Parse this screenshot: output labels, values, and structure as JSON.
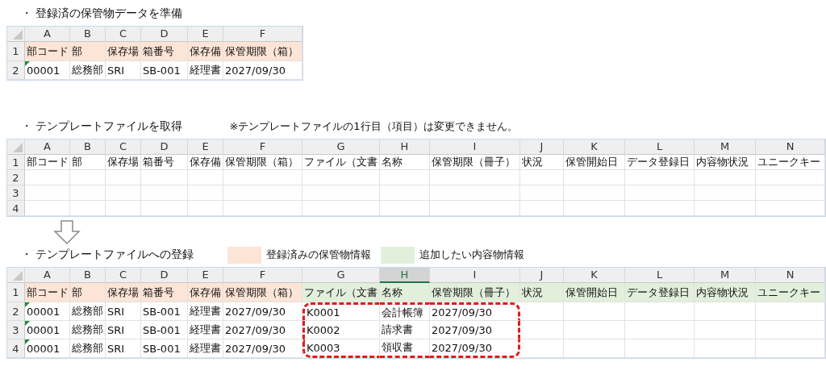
{
  "sections": [
    {
      "title": "・ 登録済の保管物データを準備",
      "sheet": {
        "columns": [
          {
            "label": "A",
            "selected": false
          },
          {
            "label": "B",
            "selected": false
          },
          {
            "label": "C",
            "selected": false
          },
          {
            "label": "D",
            "selected": false
          },
          {
            "label": "E",
            "selected": false
          },
          {
            "label": "F",
            "selected": false
          }
        ],
        "rows": [
          {
            "number": "1",
            "cells": [
              {
                "text": "部コード",
                "color": "#fce4d6"
              },
              {
                "text": "部",
                "color": "#fce4d6"
              },
              {
                "text": "保存場",
                "color": "#fce4d6"
              },
              {
                "text": "箱番号",
                "color": "#fce4d6"
              },
              {
                "text": "保存備",
                "color": "#fce4d6"
              },
              {
                "text": "保管期限（箱）",
                "color": "#fce4d6"
              }
            ]
          },
          {
            "number": "2",
            "cells": [
              {
                "text": "00001",
                "flag": true
              },
              {
                "text": "総務部"
              },
              {
                "text": "SRI"
              },
              {
                "text": "SB-001"
              },
              {
                "text": "経理書"
              },
              {
                "text": "2027/09/30"
              }
            ]
          }
        ]
      }
    },
    {
      "title": "・ テンプレートファイルを取得",
      "note": "※テンプレートファイルの1行目（項目）は変更できません。",
      "sheet": {
        "columns": [
          {
            "label": "A",
            "selected": false
          },
          {
            "label": "B",
            "selected": false
          },
          {
            "label": "C",
            "selected": false
          },
          {
            "label": "D",
            "selected": false
          },
          {
            "label": "E",
            "selected": false
          },
          {
            "label": "F",
            "selected": false
          },
          {
            "label": "G",
            "selected": false
          },
          {
            "label": "H",
            "selected": false
          },
          {
            "label": "I",
            "selected": false
          },
          {
            "label": "J",
            "selected": false
          },
          {
            "label": "K",
            "selected": false
          },
          {
            "label": "L",
            "selected": false
          },
          {
            "label": "M",
            "selected": false
          },
          {
            "label": "N",
            "selected": false
          }
        ],
        "rows": [
          {
            "number": "1",
            "cells": [
              {
                "text": "部コード"
              },
              {
                "text": "部"
              },
              {
                "text": "保存場"
              },
              {
                "text": "箱番号"
              },
              {
                "text": "保存備"
              },
              {
                "text": "保管期限（箱）"
              },
              {
                "text": "ファイル（文書"
              },
              {
                "text": "名称"
              },
              {
                "text": "保管期限（冊子）"
              },
              {
                "text": "状況"
              },
              {
                "text": "保管開始日"
              },
              {
                "text": "データ登録日"
              },
              {
                "text": "内容物状況"
              },
              {
                "text": "ユニークキー"
              }
            ]
          },
          {
            "number": "2"
          },
          {
            "number": "3"
          },
          {
            "number": "4"
          }
        ]
      }
    },
    {
      "title": "・ テンプレートファイルへの登録",
      "legend": [
        {
          "label": "登録済みの保管物情報",
          "color": "#fce4d6"
        },
        {
          "label": "追加したい内容物情報",
          "color": "#e2efda"
        }
      ],
      "sheet": {
        "columns": [
          {
            "label": "A",
            "selected": false
          },
          {
            "label": "B",
            "selected": false
          },
          {
            "label": "C",
            "selected": false
          },
          {
            "label": "D",
            "selected": false
          },
          {
            "label": "E",
            "selected": false
          },
          {
            "label": "F",
            "selected": false
          },
          {
            "label": "G",
            "selected": false
          },
          {
            "label": "H",
            "selected": true
          },
          {
            "label": "I",
            "selected": false
          },
          {
            "label": "J",
            "selected": false
          },
          {
            "label": "K",
            "selected": false
          },
          {
            "label": "L",
            "selected": false
          },
          {
            "label": "M",
            "selected": false
          },
          {
            "label": "N",
            "selected": false
          }
        ],
        "rows": [
          {
            "number": "1",
            "cells": [
              {
                "text": "部コード",
                "color": "#fce4d6"
              },
              {
                "text": "部",
                "color": "#fce4d6"
              },
              {
                "text": "保存場",
                "color": "#fce4d6"
              },
              {
                "text": "箱番号",
                "color": "#fce4d6"
              },
              {
                "text": "保存備",
                "color": "#fce4d6"
              },
              {
                "text": "保管期限（箱）",
                "color": "#fce4d6"
              },
              {
                "text": "ファイル（文書",
                "color": "#e2efda"
              },
              {
                "text": "名称",
                "color": "#e2efda"
              },
              {
                "text": "保管期限（冊子）",
                "color": "#e2efda"
              },
              {
                "text": "状況",
                "color": "#e2efda"
              },
              {
                "text": "保管開始日",
                "color": "#e2efda"
              },
              {
                "text": "データ登録日",
                "color": "#e2efda"
              },
              {
                "text": "内容物状況",
                "color": "#e2efda"
              },
              {
                "text": "ユニークキー",
                "color": "#e2efda"
              }
            ]
          },
          {
            "number": "2",
            "cells": [
              {
                "text": "00001",
                "flag": true
              },
              {
                "text": "総務部"
              },
              {
                "text": "SRI"
              },
              {
                "text": "SB-001"
              },
              {
                "text": "経理書"
              },
              {
                "text": "2027/09/30"
              },
              {
                "text": "K0001",
                "outlined": true
              },
              {
                "text": "会計帳簿",
                "outlined": true
              },
              {
                "text": "2027/09/30",
                "outlined": true
              }
            ]
          },
          {
            "number": "3",
            "cells": [
              {
                "text": "00001",
                "flag": true
              },
              {
                "text": "総務部"
              },
              {
                "text": "SRI"
              },
              {
                "text": "SB-001"
              },
              {
                "text": "経理書"
              },
              {
                "text": "2027/09/30"
              },
              {
                "text": "K0002",
                "outlined": true
              },
              {
                "text": "請求書",
                "outlined": true
              },
              {
                "text": "2027/09/30",
                "outlined": true
              }
            ]
          },
          {
            "number": "4",
            "cells": [
              {
                "text": "00001",
                "flag": true
              },
              {
                "text": "総務部"
              },
              {
                "text": "SRI"
              },
              {
                "text": "SB-001"
              },
              {
                "text": "経理書"
              },
              {
                "text": "2027/09/30"
              },
              {
                "text": "K0003",
                "outlined": true
              },
              {
                "text": "領収書",
                "outlined": true
              },
              {
                "text": "2027/09/30",
                "outlined": true
              }
            ]
          }
        ]
      }
    }
  ]
}
